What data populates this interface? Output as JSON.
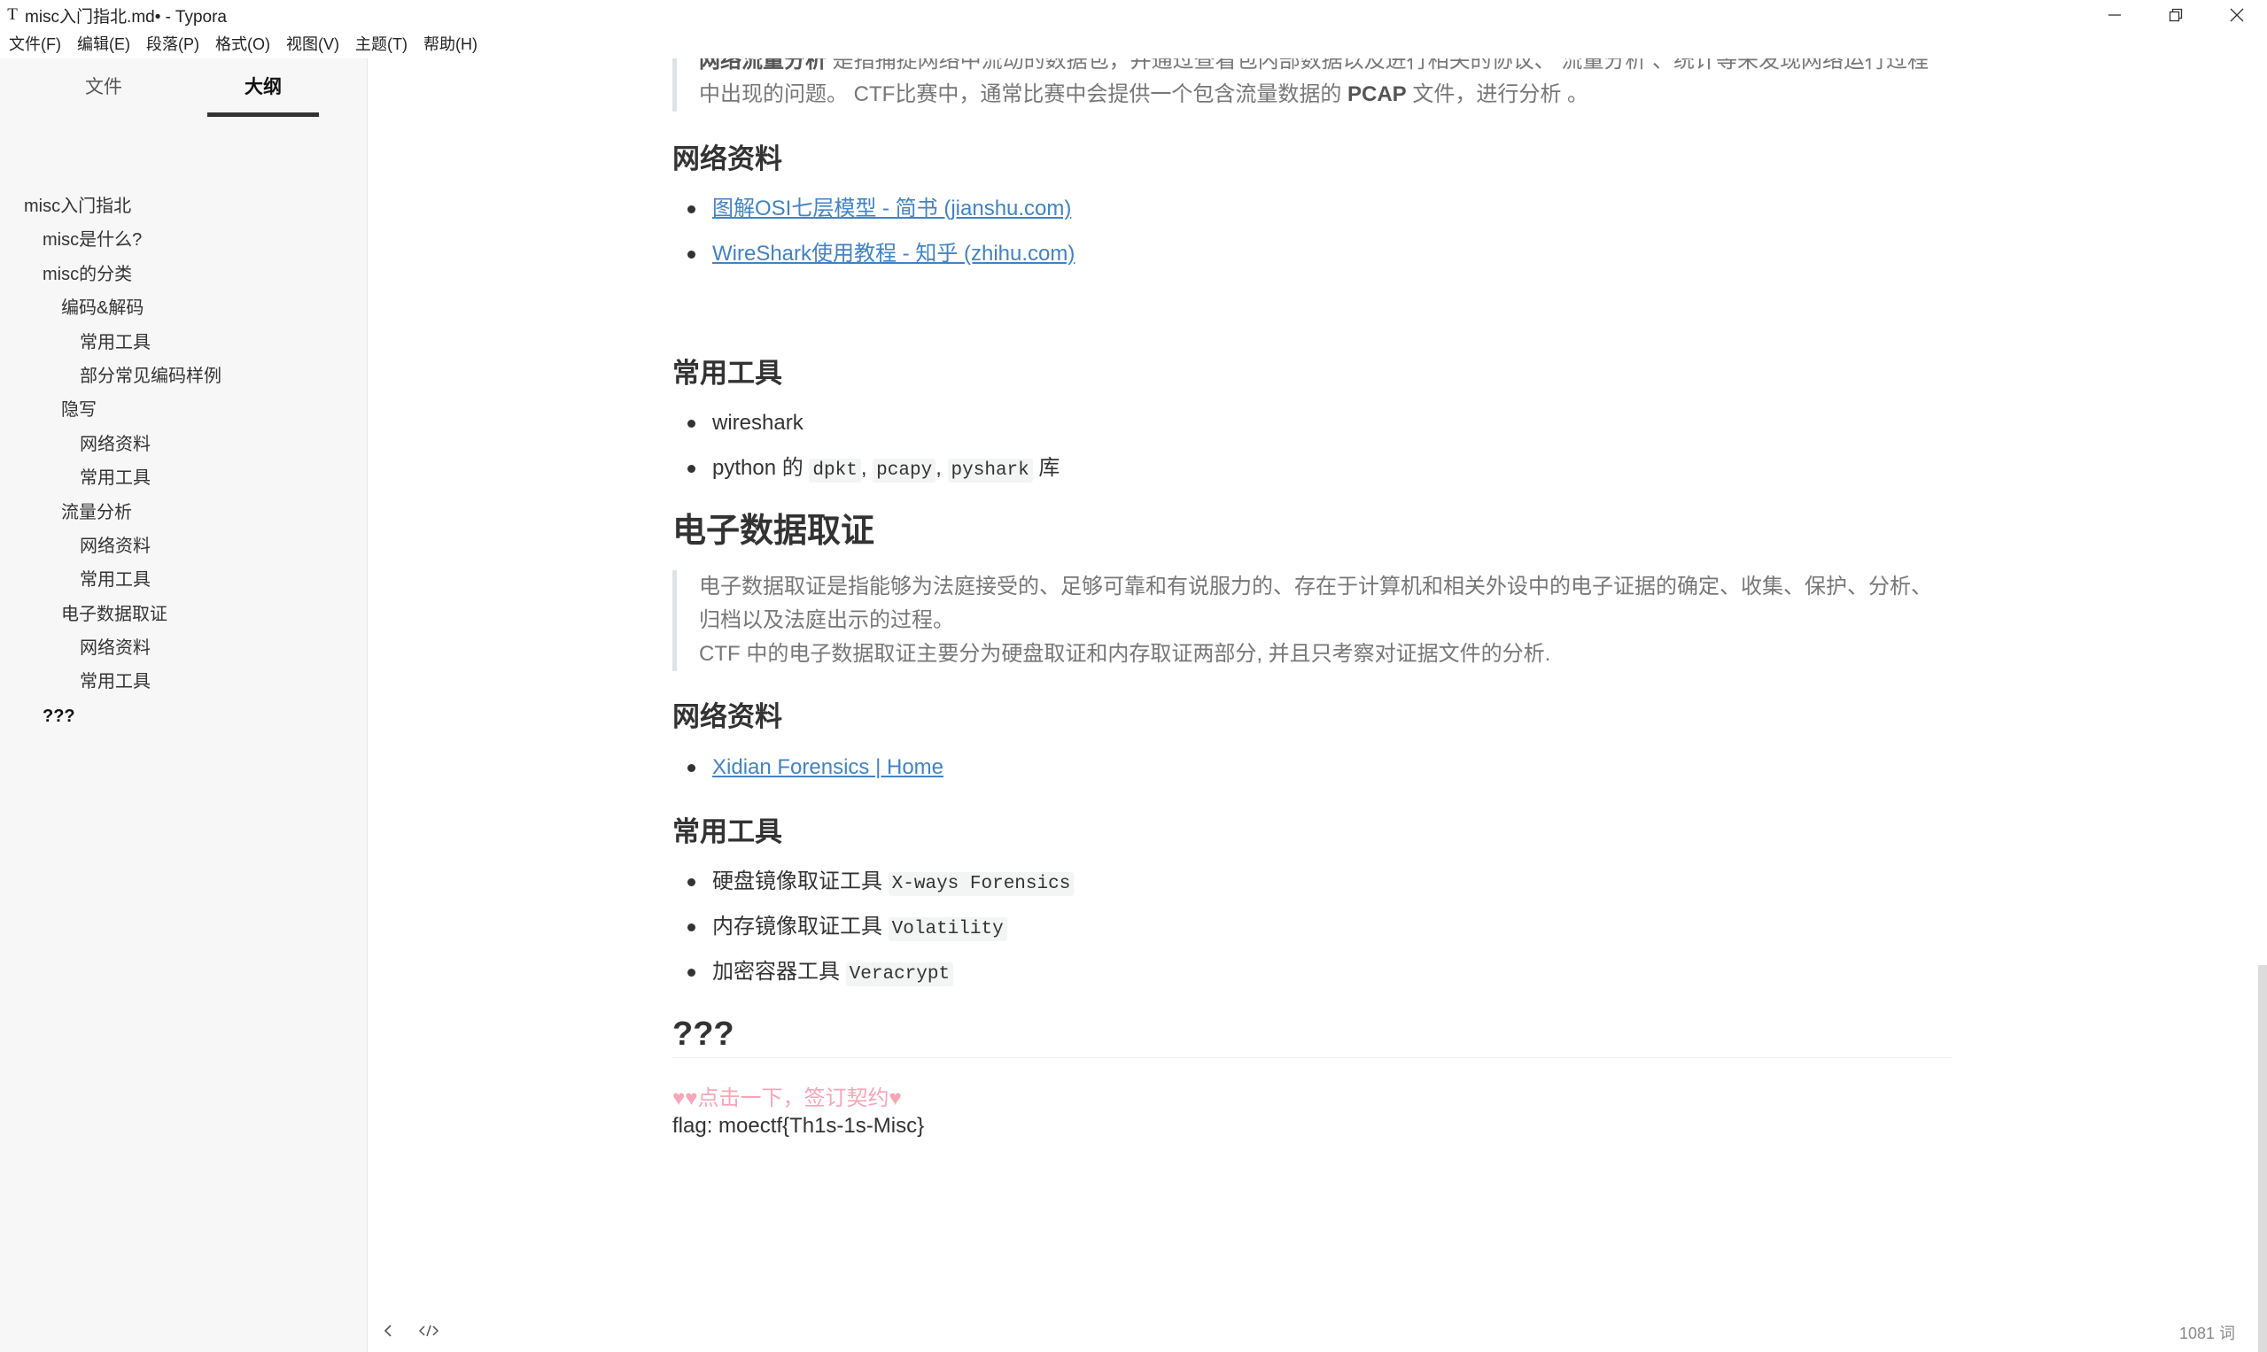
{
  "window": {
    "title": "misc入门指北.md• - Typora",
    "app_icon": "T"
  },
  "menu": [
    "文件(F)",
    "编辑(E)",
    "段落(P)",
    "格式(O)",
    "视图(V)",
    "主题(T)",
    "帮助(H)"
  ],
  "sidebar": {
    "tabs": [
      {
        "label": "文件"
      },
      {
        "label": "大纲"
      }
    ],
    "outline": [
      {
        "label": "misc入门指北",
        "level": 0
      },
      {
        "label": "misc是什么?",
        "level": 1
      },
      {
        "label": "misc的分类",
        "level": 1
      },
      {
        "label": "编码&解码",
        "level": 2
      },
      {
        "label": "常用工具",
        "level": 3
      },
      {
        "label": "部分常见编码样例",
        "level": 3
      },
      {
        "label": "隐写",
        "level": 2
      },
      {
        "label": "网络资料",
        "level": 3
      },
      {
        "label": "常用工具",
        "level": 3
      },
      {
        "label": "流量分析",
        "level": 2
      },
      {
        "label": "网络资料",
        "level": 3
      },
      {
        "label": "常用工具",
        "level": 3
      },
      {
        "label": "电子数据取证",
        "level": 2
      },
      {
        "label": "网络资料",
        "level": 3
      },
      {
        "label": "常用工具",
        "level": 3
      },
      {
        "label": "???",
        "level": 1,
        "active": true
      }
    ]
  },
  "doc": {
    "traffic": {
      "quote_bold": "网络流量分析",
      "quote_rest": " 是指捕捉网络中流动的数据包，并通过查看包内部数据以及进行相关的协议、 流量分析 、统计等来发现网络运行过程",
      "quote_line2_a": "中出现的问题。 CTF比赛中，通常比赛中会提供一个包含流量数据的 ",
      "quote_line2_b": "PCAP",
      "quote_line2_c": " 文件，进行分析 。",
      "resources_heading": "网络资料",
      "links": [
        "图解OSI七层模型 - 简书 (jianshu.com)",
        "WireShark使用教程 - 知乎 (zhihu.com)"
      ],
      "tools_heading": "常用工具",
      "tool1": "wireshark",
      "tool2_prefix": "python 的 ",
      "tool2_codes": [
        "dpkt",
        "pcapy",
        "pyshark"
      ],
      "tool2_suffix": " 库"
    },
    "forensics": {
      "heading": "电子数据取证",
      "quote_line1": "电子数据取证是指能够为法庭接受的、足够可靠和有说服力的、存在于计算机和相关外设中的电子证据的确定、收集、保护、分析、",
      "quote_line2": "归档以及法庭出示的过程。",
      "quote_line3": "CTF 中的电子数据取证主要分为硬盘取证和内存取证两部分, 并且只考察对证据文件的分析.",
      "resources_heading": "网络资料",
      "link": "Xidian Forensics | Home",
      "tools_heading": "常用工具",
      "tools": [
        {
          "label": "硬盘镜像取证工具 ",
          "code": "X-ways Forensics"
        },
        {
          "label": "内存镜像取证工具 ",
          "code": "Volatility"
        },
        {
          "label": "加密容器工具 ",
          "code": "Veracrypt"
        }
      ]
    },
    "final": {
      "heading": "???",
      "pink_text": "♥♥点击一下，签订契约♥",
      "flag": "flag: moectf{Th1s-1s-Misc}"
    }
  },
  "footer": {
    "word_count": "1081 词"
  }
}
